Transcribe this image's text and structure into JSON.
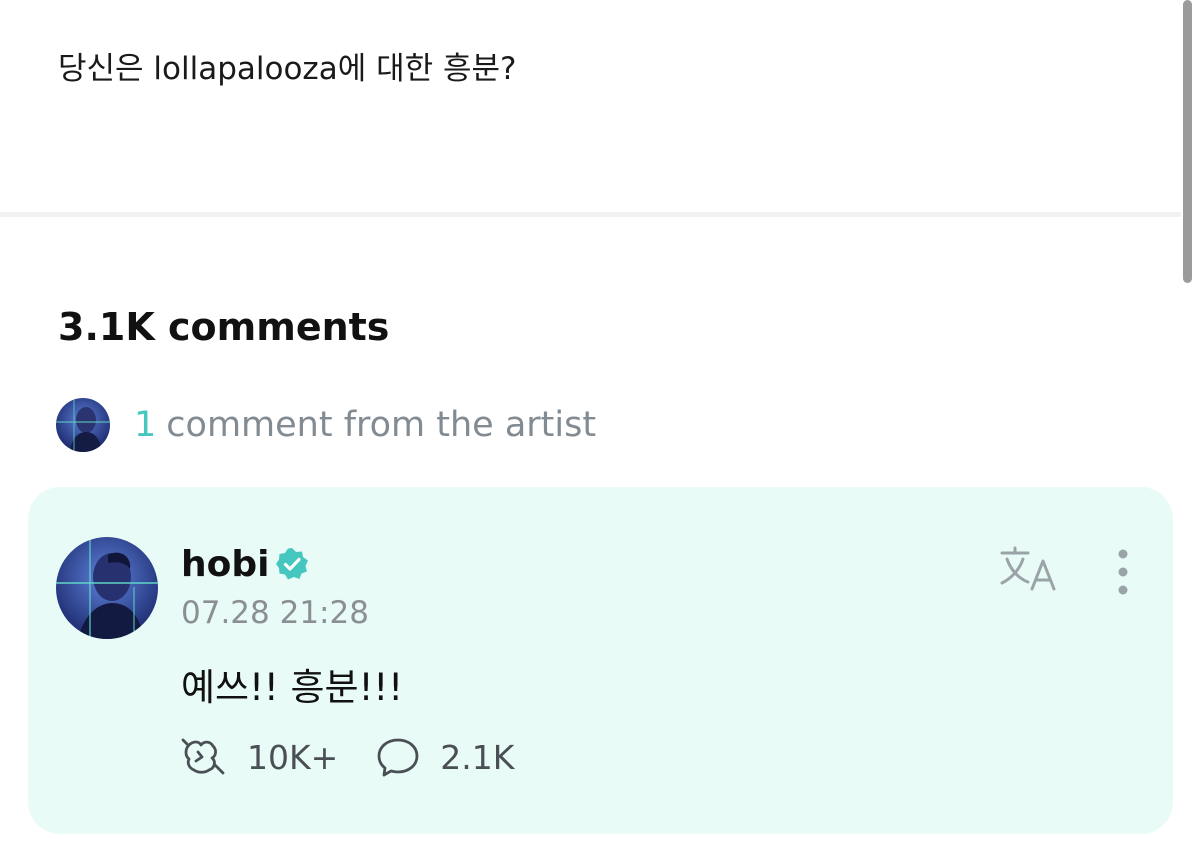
{
  "post": {
    "text": "당신은 lollapalooza에 대한 흥분?"
  },
  "comments_section": {
    "count_label": "3.1K comments",
    "artist_comment_count": "1",
    "artist_comment_label": "comment from the artist"
  },
  "artist_comment": {
    "username": "hobi",
    "timestamp": "07.28 21:28",
    "body": "예쓰!! 흥분!!!",
    "likes": "10K+",
    "replies": "2.1K",
    "translate_icon": "translate-icon",
    "more_icon": "more-vertical-icon"
  },
  "colors": {
    "accent": "#45c7c0",
    "card_background": "#e9fbf7",
    "verified_badge": "#45c7c0"
  }
}
